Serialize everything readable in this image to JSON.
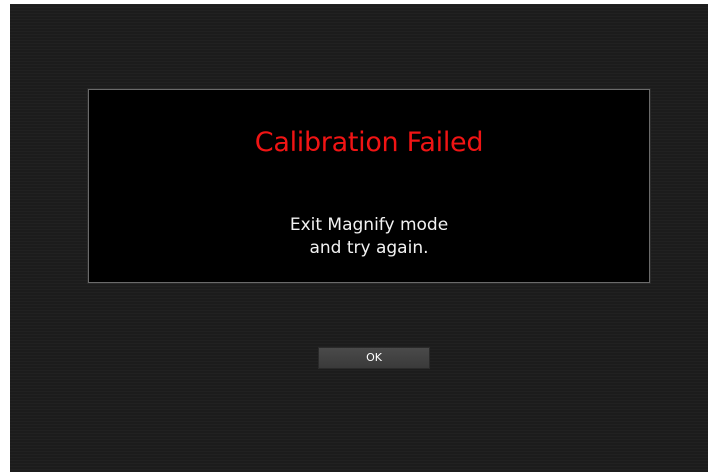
{
  "dialog": {
    "title": "Calibration Failed",
    "message_line1": "Exit Magnify mode",
    "message_line2": "and try again.",
    "title_color": "#f01414"
  },
  "actions": {
    "ok_label": "OK"
  }
}
